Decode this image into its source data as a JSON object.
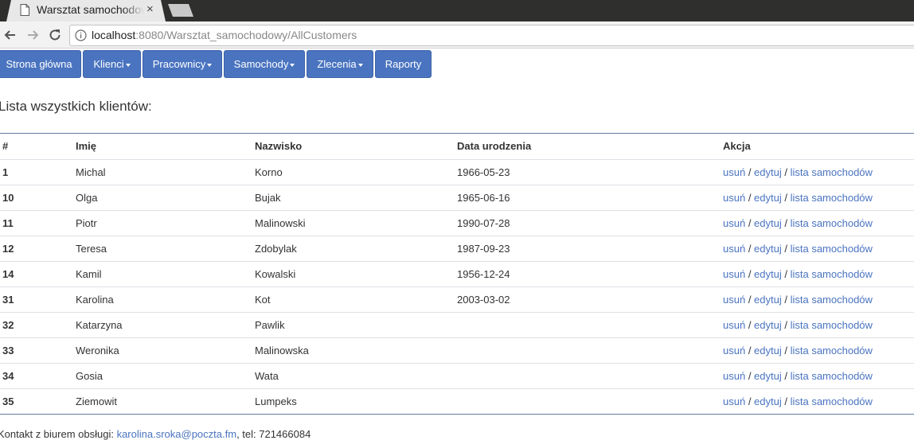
{
  "browser": {
    "tab_title": "Warsztat samochodowy",
    "tab_close": "×",
    "url_host": "localhost",
    "url_rest": ":8080/Warsztat_samochodowy/AllCustomers",
    "icons": [
      "page-icon",
      "back-arrow-icon",
      "forward-arrow-icon",
      "reload-icon",
      "info-icon"
    ]
  },
  "nav": {
    "items": [
      {
        "label": "Strona główna",
        "dropdown": false
      },
      {
        "label": "Klienci",
        "dropdown": true
      },
      {
        "label": "Pracownicy",
        "dropdown": true
      },
      {
        "label": "Samochody",
        "dropdown": true
      },
      {
        "label": "Zlecenia",
        "dropdown": true
      },
      {
        "label": "Raporty",
        "dropdown": false
      }
    ],
    "color": "#4a74c0"
  },
  "page": {
    "heading": "Lista wszystkich klientów:"
  },
  "table": {
    "headers": [
      "#",
      "Imię",
      "Nazwisko",
      "Data urodzenia",
      "Akcja"
    ],
    "rows": [
      {
        "id": "1",
        "first": "Michal",
        "last": "Korno",
        "dob": "1966-05-23"
      },
      {
        "id": "10",
        "first": "Olga",
        "last": "Bujak",
        "dob": "1965-06-16"
      },
      {
        "id": "11",
        "first": "Piotr",
        "last": "Malinowski",
        "dob": "1990-07-28"
      },
      {
        "id": "12",
        "first": "Teresa",
        "last": "Zdobylak",
        "dob": "1987-09-23"
      },
      {
        "id": "14",
        "first": "Kamil",
        "last": "Kowalski",
        "dob": "1956-12-24"
      },
      {
        "id": "31",
        "first": "Karolina",
        "last": "Kot",
        "dob": "2003-03-02"
      },
      {
        "id": "32",
        "first": "Katarzyna",
        "last": "Pawlik",
        "dob": ""
      },
      {
        "id": "33",
        "first": "Weronika",
        "last": "Malinowska",
        "dob": ""
      },
      {
        "id": "34",
        "first": "Gosia",
        "last": "Wata",
        "dob": ""
      },
      {
        "id": "35",
        "first": "Ziemowit",
        "last": "Lumpeks",
        "dob": ""
      }
    ],
    "actions": {
      "delete": "usuń",
      "edit": "edytuj",
      "cars": "lista samochodów",
      "separator": " / "
    }
  },
  "footer": {
    "prefix": "Kontakt z biurem obsługi: ",
    "email": "karolina.sroka@poczta.fm",
    "suffix": ", tel: 721466084"
  }
}
